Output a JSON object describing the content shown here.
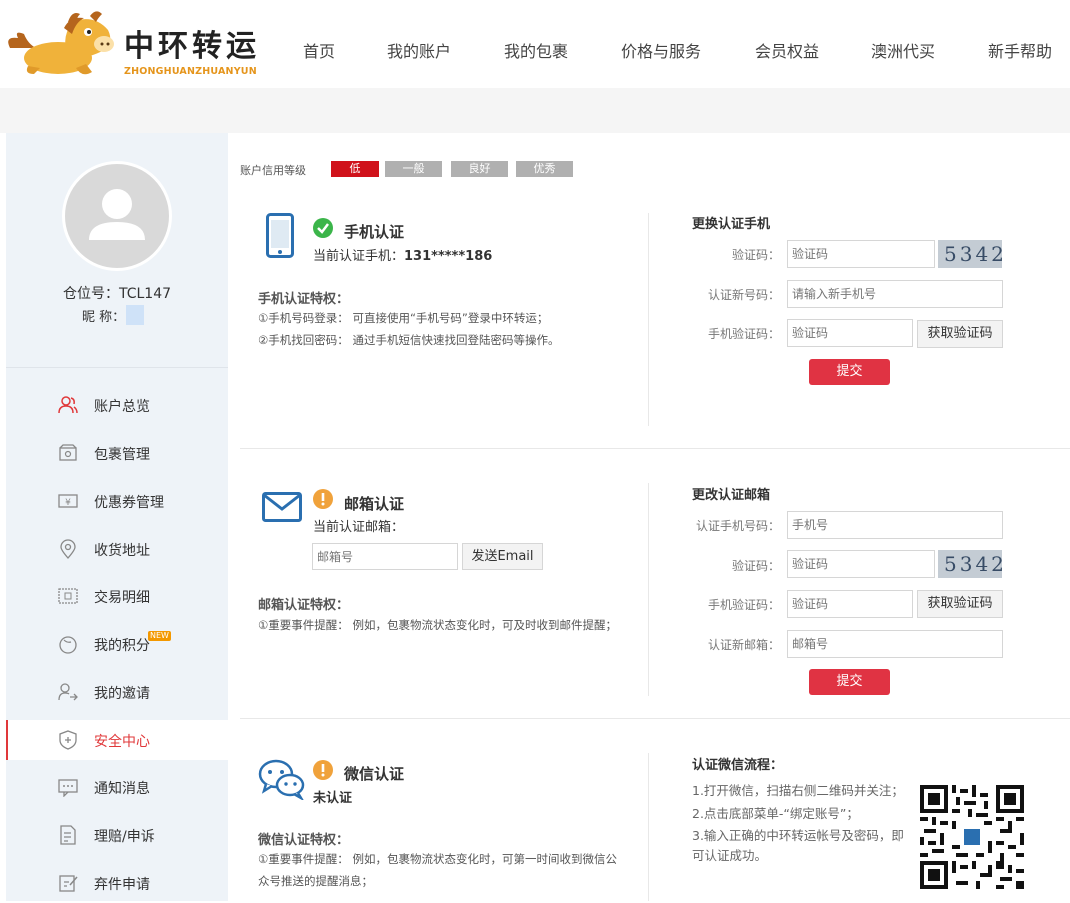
{
  "header": {
    "logo_cn": "中环转运",
    "logo_en": "ZHONGHUANZHUANYUN",
    "nav": [
      "首页",
      "我的账户",
      "我的包裹",
      "价格与服务",
      "会员权益",
      "澳洲代买",
      "新手帮助"
    ]
  },
  "sidebar": {
    "position_label": "仓位号：TCL147",
    "nickname_label": "昵 称：",
    "menu": [
      "账户总览",
      "包裹管理",
      "优惠券管理",
      "收货地址",
      "交易明细",
      "我的积分",
      "我的邀请",
      "安全中心",
      "通知消息",
      "理赔/申诉",
      "弃件申请"
    ],
    "active": "安全中心",
    "new_badge": "NEW"
  },
  "credit": {
    "label": "账户信用等级",
    "levels": [
      "低",
      "一般",
      "良好",
      "优秀"
    ],
    "current": "低"
  },
  "phone": {
    "title": "手机认证",
    "status_prefix": "当前认证手机：",
    "status_value": "131*****186",
    "privileges_title": "手机认证特权：",
    "privileges": [
      "①手机号码登录：  可直接使用“手机号码”登录中环转运；",
      "②手机找回密码：  通过手机短信快速找回登陆密码等操作。"
    ],
    "form_title": "更换认证手机",
    "captcha_label": "验证码：",
    "captcha_placeholder": "验证码",
    "captcha_image_text": "5342",
    "new_phone_label": "认证新号码：",
    "new_phone_placeholder": "请输入新手机号",
    "sms_label": "手机验证码：",
    "sms_placeholder": "验证码",
    "get_code": "获取验证码",
    "submit": "提交"
  },
  "email": {
    "title": "邮箱认证",
    "status_prefix": "当前认证邮箱：",
    "email_placeholder": "邮箱号",
    "send_button": "发送Email",
    "privileges_title": "邮箱认证特权：",
    "privileges": [
      "①重要事件提醒：  例如，包裹物流状态变化时，可及时收到邮件提醒；"
    ],
    "form_title": "更改认证邮箱",
    "phone_label": "认证手机号码：",
    "phone_placeholder": "手机号",
    "captcha_label": "验证码：",
    "captcha_placeholder": "验证码",
    "captcha_image_text": "5342",
    "sms_label": "手机验证码：",
    "sms_placeholder": "验证码",
    "get_code": "获取验证码",
    "new_email_label": "认证新邮箱：",
    "new_email_placeholder": "邮箱号",
    "submit": "提交"
  },
  "wechat": {
    "title": "微信认证",
    "status": "未认证",
    "privileges_title": "微信认证特权：",
    "privileges": "①重要事件提醒：  例如，包裹物流状态变化时，可第一时间收到微信公众号推送的提醒消息；",
    "flow_title": "认证微信流程：",
    "steps": [
      "1.打开微信，扫描右侧二维码并关注；",
      "2.点击底部菜单-“绑定账号”；",
      "3.输入正确的中环转运帐号及密码，即可认证成功。"
    ]
  },
  "colors": {
    "accent_red": "#e03343",
    "credit_low": "#d0121b",
    "sidebar_bg": "#eef3f8",
    "success_green": "#3bb54a",
    "warning_orange": "#f0a23b",
    "icon_blue": "#2a6fb0"
  }
}
